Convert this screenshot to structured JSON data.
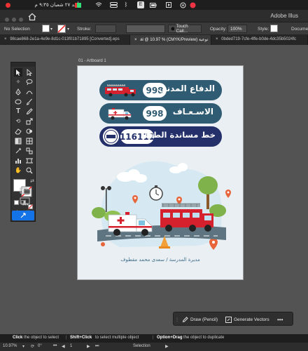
{
  "menubar": {
    "date_text": "أحد ٢٧ شعبان ٩:٣٥ م",
    "input_letter": "E"
  },
  "appbar": {
    "title": "Adobe Illus"
  },
  "control_bar": {
    "selection": "No Selection",
    "stroke_label": "Stroke:",
    "brush_name": "Touch Call...",
    "opacity_label": "Opacity:",
    "opacity_value": "100%",
    "style_label": "Style:",
    "docsetup_label": "Document"
  },
  "tabs": [
    {
      "label": "98cae868-2e1a-4e9e-8d1c-013f01b71895 [Converted].eps"
    },
    {
      "label": "ai @ 10.97 % (CMYK/Preview)  توعية",
      "active": true
    },
    {
      "label": "0bded719-7cfe-4ffe-b0de-4dc35b5024fc"
    }
  ],
  "artboard": {
    "label": "01 - Artboard 1",
    "pills": [
      {
        "text": "الدفاع المدني",
        "number": "998",
        "color": "#2f5b73",
        "num_color": "#2f5b73"
      },
      {
        "text": "الاسـعـاف",
        "number": "998",
        "color": "#2f5b73",
        "num_color": "#2f5b73"
      },
      {
        "text": "خط مساندة الطفل",
        "number": "116111",
        "color": "#23306a",
        "num_color": "#23306a"
      }
    ],
    "footer": "مديرة المدرسة / سعدى محمد مقطوف"
  },
  "floating_bar": {
    "draw_label": "Draw (Pencil)",
    "generate_label": "Generate Vectors"
  },
  "status": {
    "hint_click": "Click",
    "hint_click_desc": "the object to select",
    "hint_shift": "Shift+Click",
    "hint_shift_desc": "to select multiple object",
    "hint_option": "Option+Drag",
    "hint_option_desc": "the object to duplicate"
  },
  "bottom": {
    "zoom": "10.97%",
    "rotation": "0°",
    "page": "1",
    "mode": "Selection"
  },
  "colors": {
    "pill_blue": "#2f5b73",
    "pill_navy": "#23306a",
    "fire_red": "#d5202e"
  }
}
